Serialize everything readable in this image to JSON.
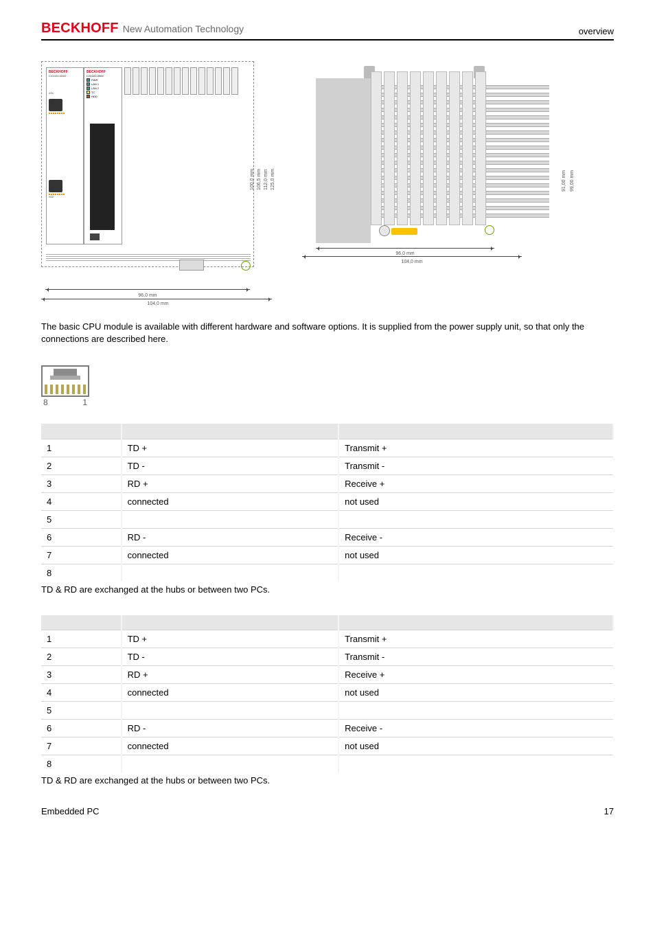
{
  "header": {
    "logo": "BECKHOFF",
    "tagline": "New Automation Technology",
    "right": "overview"
  },
  "diagrams": {
    "front": {
      "panel_left": {
        "logo": "BECKHOFF",
        "model": "CX1020-N000",
        "port1": "X01",
        "port2": "X02"
      },
      "panel_right": {
        "logo": "BECKHOFF",
        "model": "CX1020-0000",
        "leds": [
          "PWR",
          "LAN 1",
          "LAN 2",
          "TC",
          "HDD"
        ]
      },
      "dims": {
        "width_inner": "96,0 mm",
        "width_outer": "104,0 mm",
        "heights": [
          "100,0 mm",
          "106,5 mm",
          "112,0 mm",
          "125,0 mm"
        ]
      }
    },
    "top": {
      "dims": {
        "width_inner": "96,0 mm",
        "width_outer": "104,0 mm",
        "height_inner": "91,00 mm",
        "height_outer": "99,00 mm"
      }
    }
  },
  "body_text": "The basic CPU module is available with different hardware and software options. It is supplied from the power supply unit, so that only the connections are described here.",
  "rj45": {
    "left_pin": "8",
    "right_pin": "1"
  },
  "pin_tables": [
    {
      "rows": [
        {
          "pin": "1",
          "signal": "TD +",
          "desc": "Transmit +"
        },
        {
          "pin": "2",
          "signal": "TD -",
          "desc": "Transmit -"
        },
        {
          "pin": "3",
          "signal": "RD +",
          "desc": "Receive +"
        },
        {
          "pin": "4",
          "signal": "connected",
          "desc": "not used"
        },
        {
          "pin": "5",
          "signal": "",
          "desc": ""
        },
        {
          "pin": "6",
          "signal": "RD -",
          "desc": "Receive -"
        },
        {
          "pin": "7",
          "signal": "connected",
          "desc": "not used"
        },
        {
          "pin": "8",
          "signal": "",
          "desc": ""
        }
      ],
      "note": "TD & RD are exchanged at the hubs or between two PCs."
    },
    {
      "rows": [
        {
          "pin": "1",
          "signal": "TD +",
          "desc": "Transmit +"
        },
        {
          "pin": "2",
          "signal": "TD -",
          "desc": "Transmit -"
        },
        {
          "pin": "3",
          "signal": "RD +",
          "desc": "Receive +"
        },
        {
          "pin": "4",
          "signal": "connected",
          "desc": "not used"
        },
        {
          "pin": "5",
          "signal": "",
          "desc": ""
        },
        {
          "pin": "6",
          "signal": "RD -",
          "desc": "Receive -"
        },
        {
          "pin": "7",
          "signal": "connected",
          "desc": "not used"
        },
        {
          "pin": "8",
          "signal": "",
          "desc": ""
        }
      ],
      "note": "TD & RD are exchanged at the hubs or between two PCs."
    }
  ],
  "footer": {
    "left": "Embedded PC",
    "right": "17"
  }
}
